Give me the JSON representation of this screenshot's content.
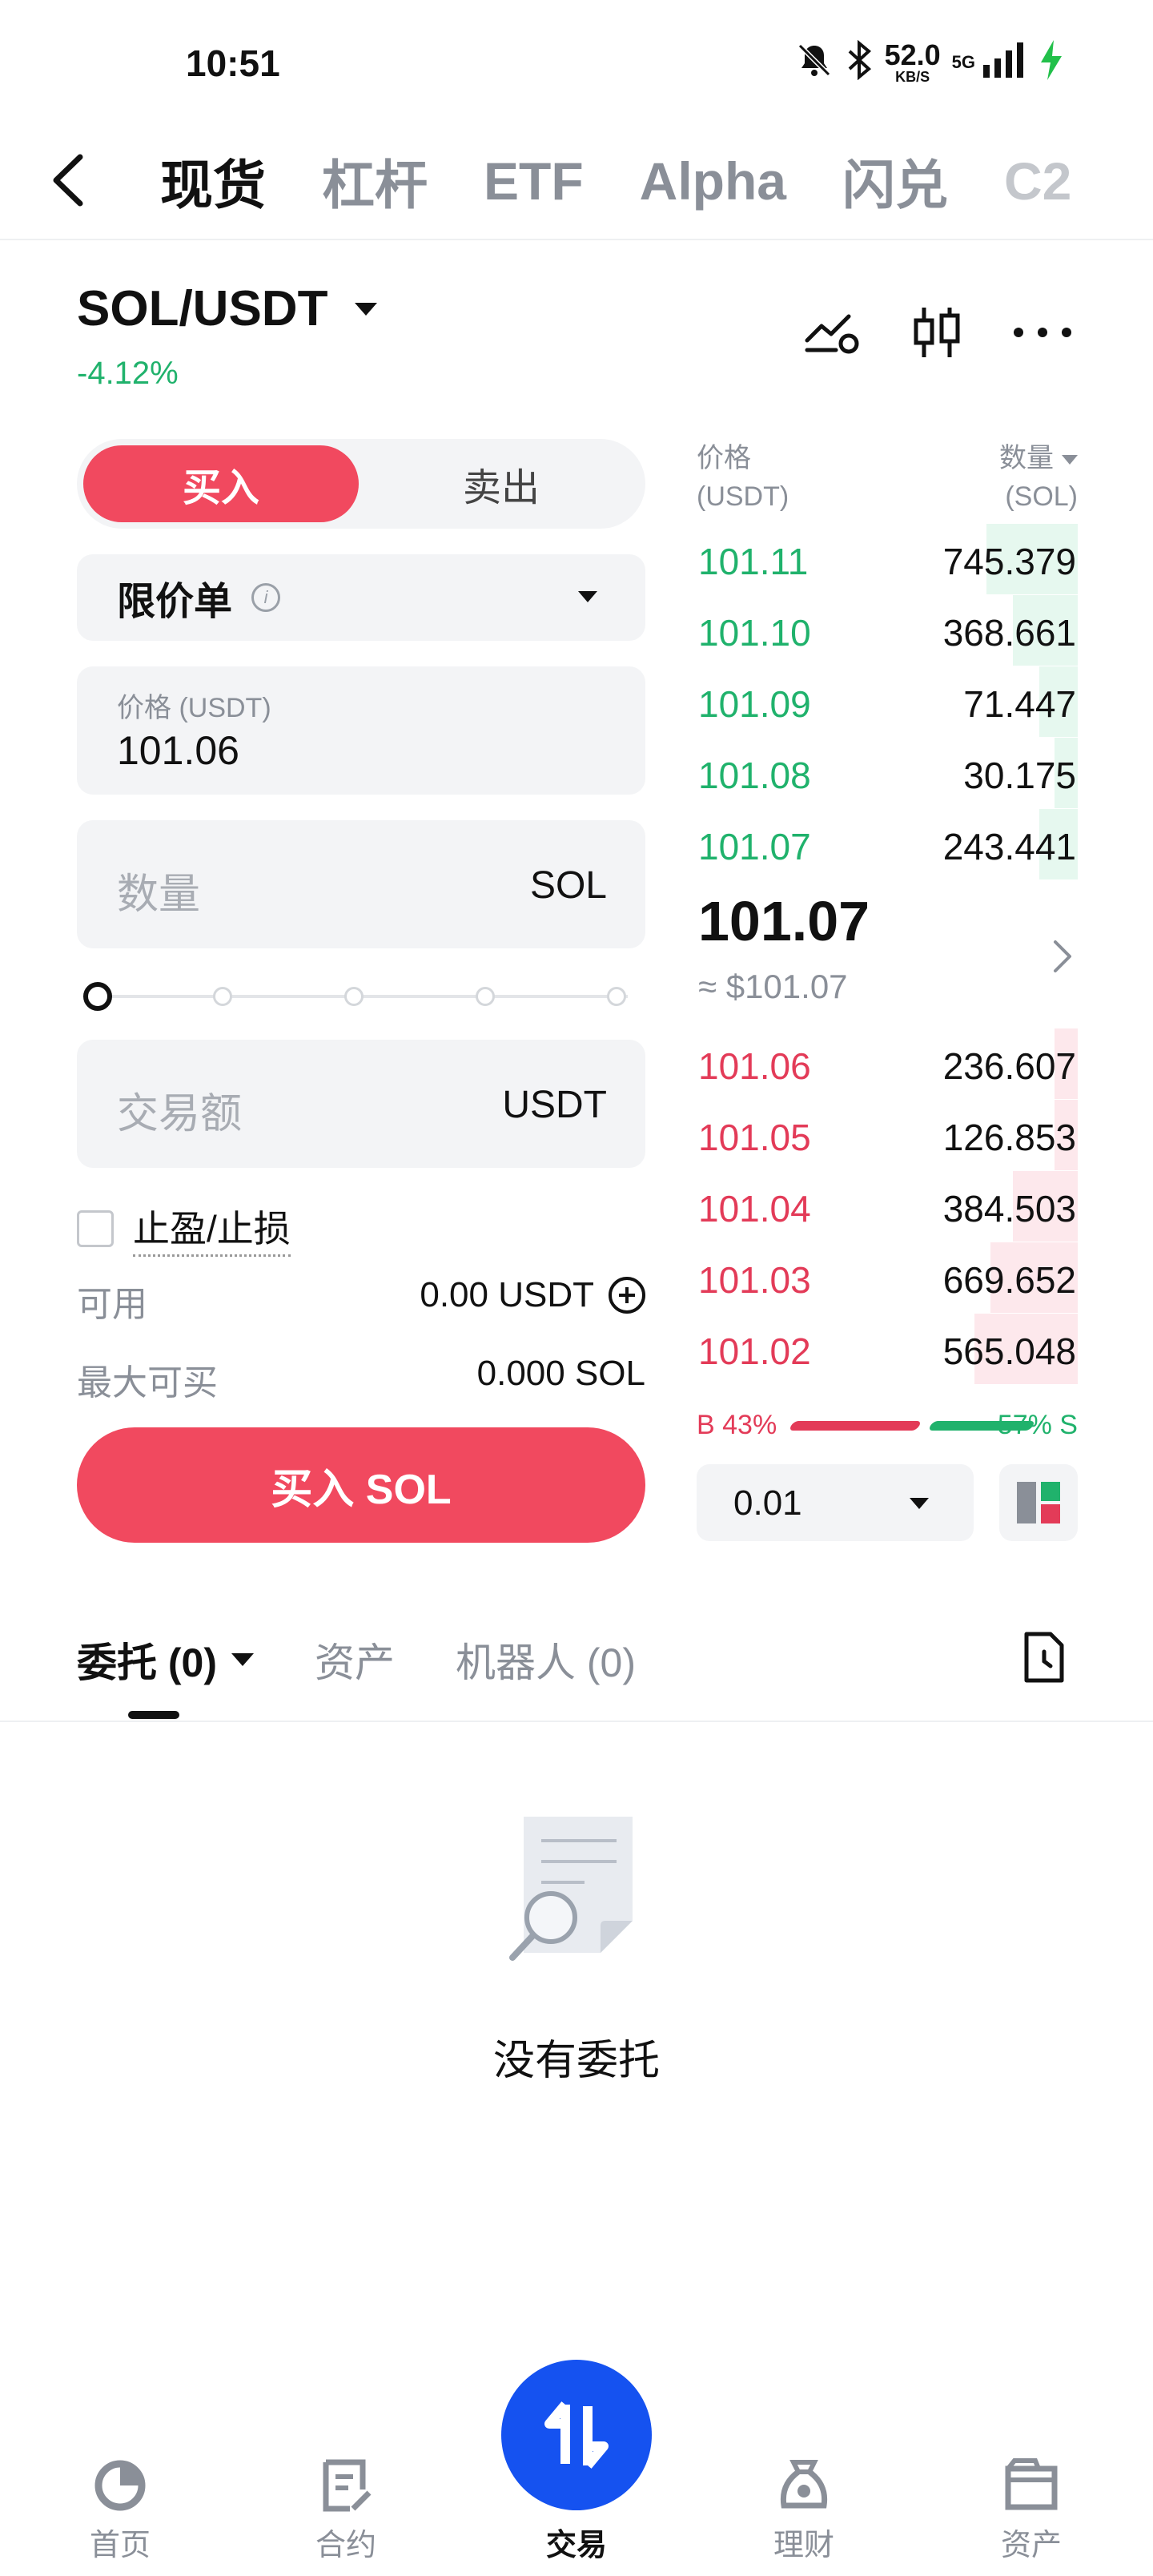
{
  "status_bar": {
    "time": "10:51",
    "net_speed": "52.0",
    "net_unit": "KB/S",
    "network": "5G"
  },
  "top_tabs": [
    "现货",
    "杠杆",
    "ETF",
    "Alpha",
    "闪兑",
    "C2"
  ],
  "pair": {
    "symbol": "SOL/USDT",
    "change": "-4.12%",
    "change_color": "#20b26c"
  },
  "trade_form": {
    "buy_tab": "买入",
    "sell_tab": "卖出",
    "order_type": "限价单",
    "info_glyph": "i",
    "price_label": "价格 (USDT)",
    "price_value": "101.06",
    "qty_placeholder": "数量",
    "qty_unit": "SOL",
    "slider_percent": 0,
    "amount_placeholder": "交易额",
    "amount_unit": "USDT",
    "tp_sl_label": "止盈/止损",
    "available_label": "可用",
    "available_value": "0.00 USDT",
    "max_buy_label": "最大可买",
    "max_buy_value": "0.000 SOL",
    "submit_label": "买入 SOL",
    "buy_color": "#f1495f"
  },
  "order_book": {
    "price_header": "价格",
    "price_header_unit": "(USDT)",
    "qty_header": "数量",
    "qty_header_unit": "(SOL)",
    "asks": [
      {
        "price": "101.11",
        "qty": "745.379",
        "depth": 0.24
      },
      {
        "price": "101.10",
        "qty": "368.661",
        "depth": 0.17
      },
      {
        "price": "101.09",
        "qty": "71.447",
        "depth": 0.1
      },
      {
        "price": "101.08",
        "qty": "30.175",
        "depth": 0.06
      },
      {
        "price": "101.07",
        "qty": "243.441",
        "depth": 0.1
      }
    ],
    "mid_price": "101.07",
    "mid_usd": "≈ $101.07",
    "bids": [
      {
        "price": "101.06",
        "qty": "236.607",
        "depth": 0.06
      },
      {
        "price": "101.05",
        "qty": "126.853",
        "depth": 0.06
      },
      {
        "price": "101.04",
        "qty": "384.503",
        "depth": 0.17
      },
      {
        "price": "101.03",
        "qty": "669.652",
        "depth": 0.23
      },
      {
        "price": "101.02",
        "qty": "565.048",
        "depth": 0.27
      }
    ],
    "buy_ratio": "B 43%",
    "sell_ratio": "57% S",
    "precision": "0.01",
    "ask_color": "#20b26c",
    "bid_color": "#e33b58"
  },
  "orders": {
    "tabs": [
      "委托 (0)",
      "资产",
      "机器人 (0)"
    ],
    "empty_text": "没有委托"
  },
  "bottom_nav": {
    "items": [
      "首页",
      "合约",
      "交易",
      "理财",
      "资产"
    ],
    "fab_color": "#1552f0"
  }
}
